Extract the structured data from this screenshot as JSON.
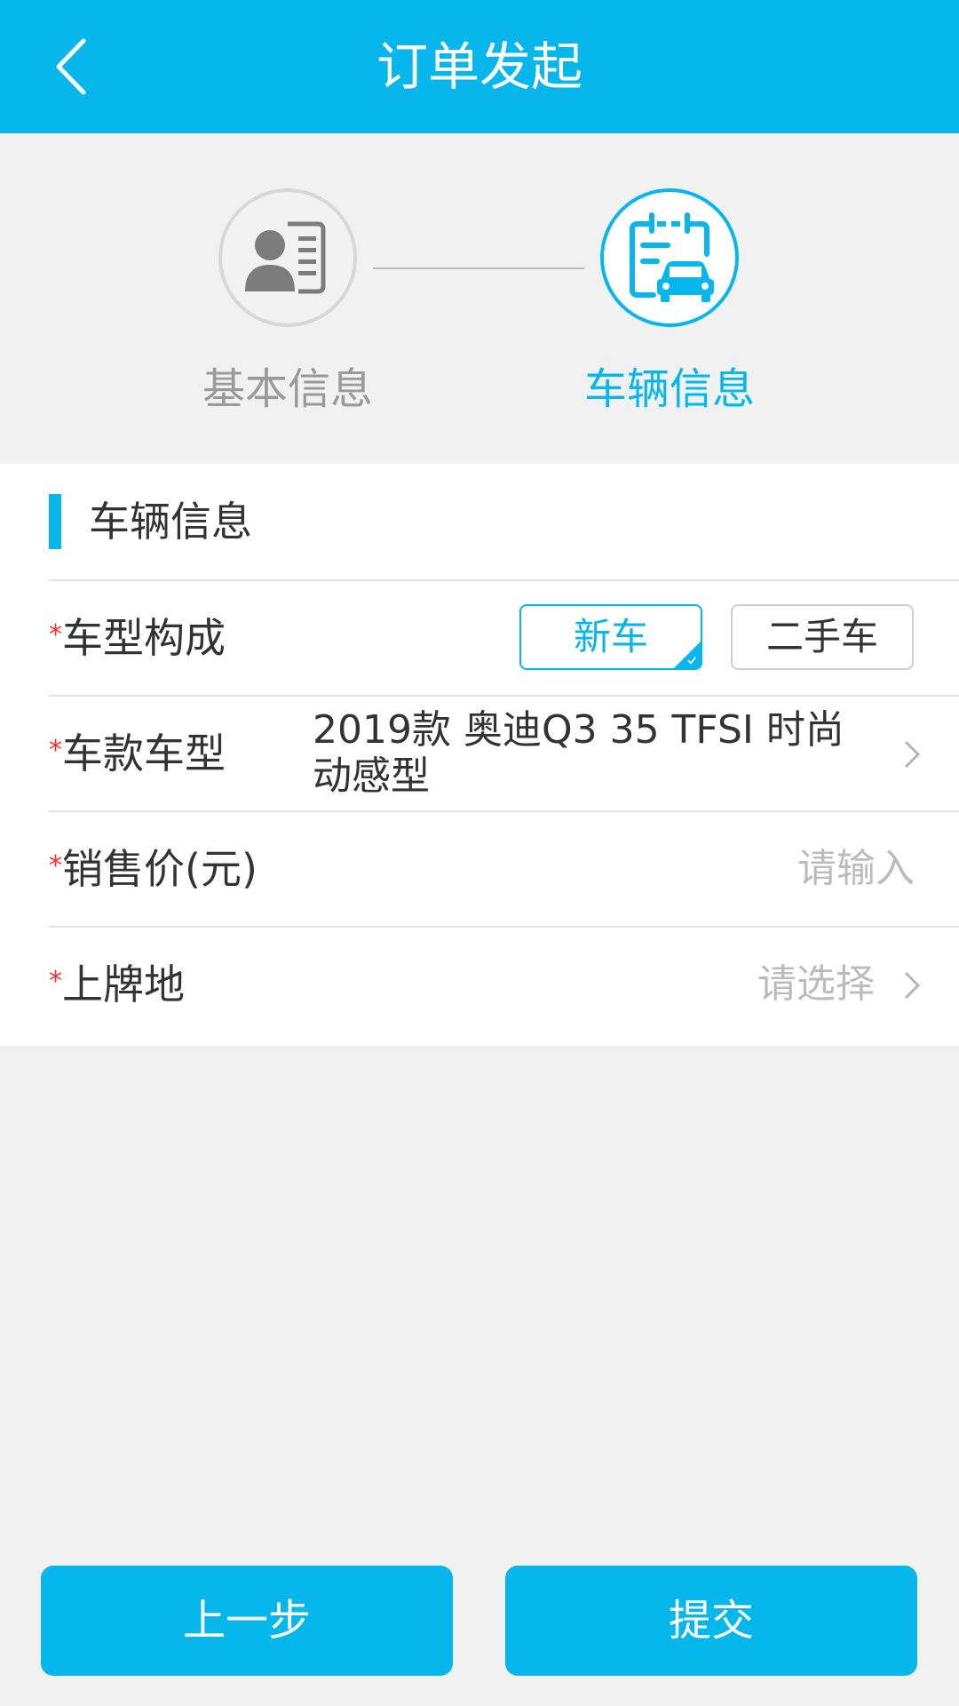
{
  "header": {
    "title": "订单发起"
  },
  "steps": [
    {
      "label": "基本信息",
      "state": "done"
    },
    {
      "label": "车辆信息",
      "state": "active"
    }
  ],
  "section": {
    "title": "车辆信息"
  },
  "form": {
    "required_mark": "*",
    "car_type": {
      "label": "车型构成",
      "options": [
        "新车",
        "二手车"
      ],
      "selected": "新车"
    },
    "model": {
      "label": "车款车型",
      "value": "2019款 奥迪Q3 35 TFSI 时尚动感型"
    },
    "price": {
      "label": "销售价(元)",
      "placeholder": "请输入"
    },
    "location": {
      "label": "上牌地",
      "placeholder": "请选择"
    }
  },
  "footer": {
    "prev_label": "上一步",
    "submit_label": "提交"
  },
  "colors": {
    "accent": "#07b6ea",
    "required": "#ff2d2d",
    "background": "#f1f1f1",
    "placeholder": "#bcbcbc"
  }
}
